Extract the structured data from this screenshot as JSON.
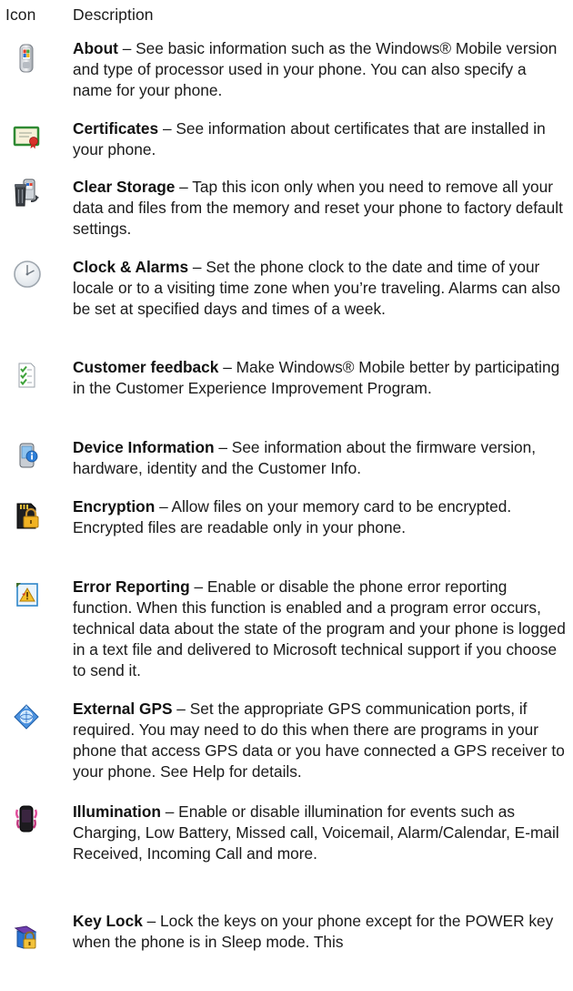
{
  "header": {
    "icon_col": "Icon",
    "desc_col": "Description"
  },
  "items": [
    {
      "icon": "about-phone-icon",
      "title": "About",
      "text": " – See basic information such as the Windows® Mobile version and type of processor used in your phone. You can also specify a name for your phone."
    },
    {
      "icon": "certificates-icon",
      "title": "Certificates",
      "text": " – See information about certificates that are installed in your phone."
    },
    {
      "icon": "clear-storage-icon",
      "title": "Clear Storage",
      "text": " – Tap this icon only when you need to remove all your data and files from the memory and reset your phone to factory default settings."
    },
    {
      "icon": "clock-icon",
      "title": "Clock & Alarms",
      "text": " – Set the phone clock to the date and time of your locale or to a visiting time zone when you’re traveling. Alarms can also be set at specified days and times of a week."
    },
    {
      "icon": "customer-feedback-icon",
      "title": "Customer feedback",
      "text": " – Make Windows® Mobile better by participating in the Customer Experience Improvement Program."
    },
    {
      "icon": "device-information-icon",
      "title": "Device Information",
      "text": " – See information about the firmware version, hardware, identity and the Customer Info."
    },
    {
      "icon": "encryption-lock-icon",
      "title": "Encryption",
      "text": " – Allow files on your memory card to be encrypted. Encrypted files are readable only in your phone."
    },
    {
      "icon": "error-reporting-icon",
      "title": "Error Reporting",
      "text": " – Enable or disable the phone error reporting function. When this function is enabled and a program error occurs, technical data about the state of the program and your phone is logged in a text file and delivered to Microsoft technical support if you choose to send it."
    },
    {
      "icon": "external-gps-icon",
      "title": "External GPS",
      "text": " – Set the appropriate GPS communication ports, if required. You may need to do this when there are programs in your phone that access GPS data or you have connected a GPS receiver to your phone. See Help for details."
    },
    {
      "icon": "illumination-icon",
      "title": "Illumination",
      "text": " – Enable or disable illumination for events such as Charging, Low Battery, Missed call, Voicemail, Alarm/Calendar, E-mail Received, Incoming Call and more."
    },
    {
      "icon": "key-lock-icon",
      "title": "Key Lock",
      "text": " – Lock the keys on your phone except for the POWER key when the phone is in Sleep mode. This"
    }
  ]
}
